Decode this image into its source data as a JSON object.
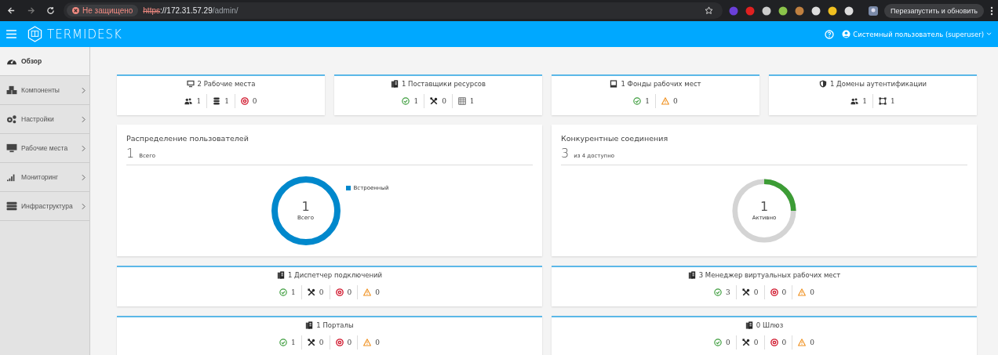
{
  "browser": {
    "security": "Не защищено",
    "url_scheme": "https",
    "url_host": "://172.31.57.29",
    "url_path": "/admin/",
    "update_button": "Перезапустить и обновить"
  },
  "header": {
    "logo": "TERMIDESK",
    "user": "Системный пользователь (superuser)"
  },
  "sidebar": {
    "items": [
      {
        "label": "Обзор",
        "kind": "dashboard",
        "selected": true,
        "expandable": false
      },
      {
        "label": "Компоненты",
        "kind": "cubes",
        "selected": false,
        "expandable": true
      },
      {
        "label": "Настройки",
        "kind": "gears",
        "selected": false,
        "expandable": true
      },
      {
        "label": "Рабочие места",
        "kind": "monitor",
        "selected": false,
        "expandable": true
      },
      {
        "label": "Мониторинг",
        "kind": "signal",
        "selected": false,
        "expandable": true
      },
      {
        "label": "Инфраструктура",
        "kind": "server",
        "selected": false,
        "expandable": true
      }
    ]
  },
  "summary_cards": [
    {
      "kind": "monitor",
      "title": "2 Рабочие места",
      "stats": [
        {
          "kind": "users",
          "value": "1"
        },
        {
          "kind": "database",
          "value": "1"
        },
        {
          "kind": "error",
          "value": "0"
        }
      ]
    },
    {
      "kind": "document",
      "title": "1 Поставщики ресурсов",
      "stats": [
        {
          "kind": "ok",
          "value": "1"
        },
        {
          "kind": "tools",
          "value": "0"
        },
        {
          "kind": "grid",
          "value": "1"
        }
      ]
    },
    {
      "kind": "pool",
      "title": "1 Фонды рабочих мест",
      "stats": [
        {
          "kind": "ok",
          "value": "1"
        },
        {
          "kind": "warning",
          "value": "0"
        }
      ]
    },
    {
      "kind": "shield",
      "title": "1 Домены аутентификации",
      "stats": [
        {
          "kind": "users",
          "value": "1"
        },
        {
          "kind": "frame",
          "value": "1"
        }
      ]
    }
  ],
  "users_panel": {
    "title": "Распределение пользователей",
    "count": "1",
    "count_label": "Всего",
    "center_value": "1",
    "center_label": "Всего",
    "legend": [
      {
        "label": "Встроенный",
        "color": "#0088cc"
      }
    ]
  },
  "connections_panel": {
    "title": "Конкурентные соединения",
    "count": "3",
    "count_label": "из 4 доступно",
    "center_value": "1",
    "center_label": "Активно",
    "level": 0.25
  },
  "component_cards": [
    {
      "title": "1 Диспетчер подключений",
      "stats": [
        {
          "kind": "ok",
          "value": "1"
        },
        {
          "kind": "tools",
          "value": "0"
        },
        {
          "kind": "error",
          "value": "0"
        },
        {
          "kind": "warning",
          "value": "0"
        }
      ]
    },
    {
      "title": "3 Менеджер виртуальных рабочих мест",
      "stats": [
        {
          "kind": "ok",
          "value": "3"
        },
        {
          "kind": "tools",
          "value": "0"
        },
        {
          "kind": "error",
          "value": "0"
        },
        {
          "kind": "warning",
          "value": "0"
        }
      ]
    },
    {
      "title": "1 Порталы",
      "stats": [
        {
          "kind": "ok",
          "value": "1"
        },
        {
          "kind": "tools",
          "value": "0"
        },
        {
          "kind": "error",
          "value": "0"
        },
        {
          "kind": "warning",
          "value": "0"
        }
      ]
    },
    {
      "title": "0 Шлюз",
      "stats": [
        {
          "kind": "ok",
          "value": "0"
        },
        {
          "kind": "tools",
          "value": "0"
        },
        {
          "kind": "error",
          "value": "0"
        },
        {
          "kind": "warning",
          "value": "0"
        }
      ]
    }
  ]
}
